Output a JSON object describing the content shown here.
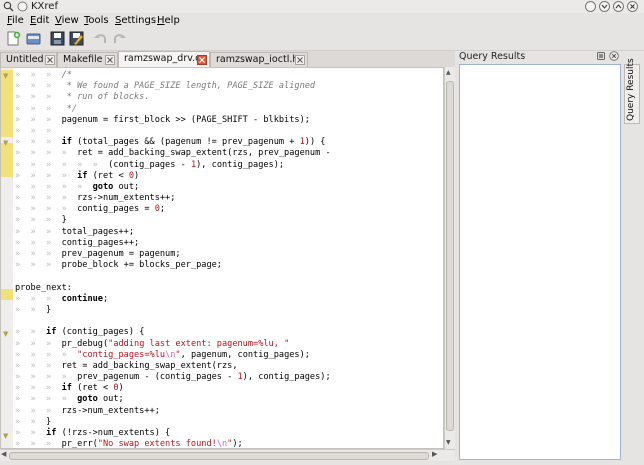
{
  "window": {
    "title": "KXref"
  },
  "menu": [
    {
      "label": "File",
      "ul": "F",
      "rest": "ile"
    },
    {
      "label": "Edit",
      "ul": "E",
      "rest": "dit"
    },
    {
      "label": "View",
      "ul": "V",
      "rest": "iew"
    },
    {
      "label": "Tools",
      "ul": "T",
      "rest": "ools"
    },
    {
      "label": "Settings",
      "ul": "S",
      "rest": "ettings"
    },
    {
      "label": "Help",
      "ul": "H",
      "rest": "elp"
    }
  ],
  "tabs": [
    {
      "label": "Untitled"
    },
    {
      "label": "Makefile"
    },
    {
      "label": "ramzswap_drv.c"
    },
    {
      "label": "ramzswap_ioctl.h"
    }
  ],
  "query_panel": {
    "title": "Query Results",
    "side_tab": "Query Results"
  },
  "colors": {
    "keyword": "#000000",
    "string": "#c0101a",
    "comment": "#7a7a7a",
    "change_bar": "#f2e07a",
    "panel_border": "#9fb4cc"
  },
  "code_lines": [
    [
      [
        "d",
        "»  »  »  "
      ],
      [
        "c",
        "/*"
      ]
    ],
    [
      [
        "d",
        "»  »  »  "
      ],
      [
        "c",
        " * We found a PAGE_SIZE length, PAGE_SIZE aligned"
      ]
    ],
    [
      [
        "d",
        "»  »  »  "
      ],
      [
        "c",
        " * run of blocks."
      ]
    ],
    [
      [
        "d",
        "»  »  »  "
      ],
      [
        "c",
        " */"
      ]
    ],
    [
      [
        "d",
        "»  »  »  "
      ],
      [
        "t",
        "pagenum = first_block >> (PAGE_SHIFT - blkbits);"
      ]
    ],
    [
      [
        "d",
        "»  »  »  "
      ]
    ],
    [
      [
        "d",
        "»  »  »  "
      ],
      [
        "k",
        "if"
      ],
      [
        "t",
        " (total_pages && (pagenum != prev_pagenum + "
      ],
      [
        "n",
        "1"
      ],
      [
        "t",
        ")) {"
      ]
    ],
    [
      [
        "d",
        "»  »  »  »  "
      ],
      [
        "t",
        "ret = add_backing_swap_extent(rzs, prev_pagenum -"
      ]
    ],
    [
      [
        "d",
        "»  »  »  »  »  »  "
      ],
      [
        "t",
        "(contig_pages - "
      ],
      [
        "n",
        "1"
      ],
      [
        "t",
        "), contig_pages);"
      ]
    ],
    [
      [
        "d",
        "»  »  »  »  "
      ],
      [
        "k",
        "if"
      ],
      [
        "t",
        " (ret < "
      ],
      [
        "n",
        "0"
      ],
      [
        "t",
        ")"
      ]
    ],
    [
      [
        "d",
        "»  »  »  »  »  "
      ],
      [
        "k",
        "goto"
      ],
      [
        "t",
        " out;"
      ]
    ],
    [
      [
        "d",
        "»  »  »  »  "
      ],
      [
        "t",
        "rzs->num_extents++;"
      ]
    ],
    [
      [
        "d",
        "»  »  »  »  "
      ],
      [
        "t",
        "contig_pages = "
      ],
      [
        "n",
        "0"
      ],
      [
        "t",
        ";"
      ]
    ],
    [
      [
        "d",
        "»  »  »  "
      ],
      [
        "t",
        "}"
      ]
    ],
    [
      [
        "d",
        "»  »  »  "
      ],
      [
        "t",
        "total_pages++;"
      ]
    ],
    [
      [
        "d",
        "»  »  »  "
      ],
      [
        "t",
        "contig_pages++;"
      ]
    ],
    [
      [
        "d",
        "»  »  »  "
      ],
      [
        "t",
        "prev_pagenum = pagenum;"
      ]
    ],
    [
      [
        "d",
        "»  »  »  "
      ],
      [
        "t",
        "probe_block += blocks_per_page;"
      ]
    ],
    [
      [
        "d",
        ""
      ]
    ],
    [
      [
        "t",
        "probe_next:"
      ]
    ],
    [
      [
        "d",
        "»  »  »  "
      ],
      [
        "k",
        "continue"
      ],
      [
        "t",
        ";"
      ]
    ],
    [
      [
        "d",
        "»  »  "
      ],
      [
        "t",
        "}"
      ]
    ],
    [
      [
        "d",
        ""
      ]
    ],
    [
      [
        "d",
        "»  »  "
      ],
      [
        "k",
        "if"
      ],
      [
        "t",
        " (contig_pages) {"
      ]
    ],
    [
      [
        "d",
        "»  »  »  "
      ],
      [
        "t",
        "pr_debug("
      ],
      [
        "s",
        "\"adding last extent: pagenum=%lu, \""
      ]
    ],
    [
      [
        "d",
        "»  »  »  »  "
      ],
      [
        "s",
        "\"contig_pages=%lu"
      ],
      [
        "e",
        "\\n"
      ],
      [
        "s",
        "\""
      ],
      [
        "t",
        ", pagenum, contig_pages);"
      ]
    ],
    [
      [
        "d",
        "»  »  »  "
      ],
      [
        "t",
        "ret = add_backing_swap_extent(rzs,"
      ]
    ],
    [
      [
        "d",
        "»  »  »  »  "
      ],
      [
        "t",
        "prev_pagenum - (contig_pages - "
      ],
      [
        "n",
        "1"
      ],
      [
        "t",
        "), contig_pages);"
      ]
    ],
    [
      [
        "d",
        "»  »  »  "
      ],
      [
        "k",
        "if"
      ],
      [
        "t",
        " (ret < "
      ],
      [
        "n",
        "0"
      ],
      [
        "t",
        ")"
      ]
    ],
    [
      [
        "d",
        "»  »  »  »  "
      ],
      [
        "k",
        "goto"
      ],
      [
        "t",
        " out;"
      ]
    ],
    [
      [
        "d",
        "»  »  »  "
      ],
      [
        "t",
        "rzs->num_extents++;"
      ]
    ],
    [
      [
        "d",
        "»  »  "
      ],
      [
        "t",
        "}"
      ]
    ],
    [
      [
        "d",
        "»  »  "
      ],
      [
        "k",
        "if"
      ],
      [
        "t",
        " (!rzs->num_extents) {"
      ]
    ],
    [
      [
        "d",
        "»  »  »  "
      ],
      [
        "t",
        "pr_err("
      ],
      [
        "s",
        "\"No swap extents found!"
      ],
      [
        "e",
        "\\n"
      ],
      [
        "s",
        "\""
      ],
      [
        "t",
        ");"
      ]
    ]
  ]
}
